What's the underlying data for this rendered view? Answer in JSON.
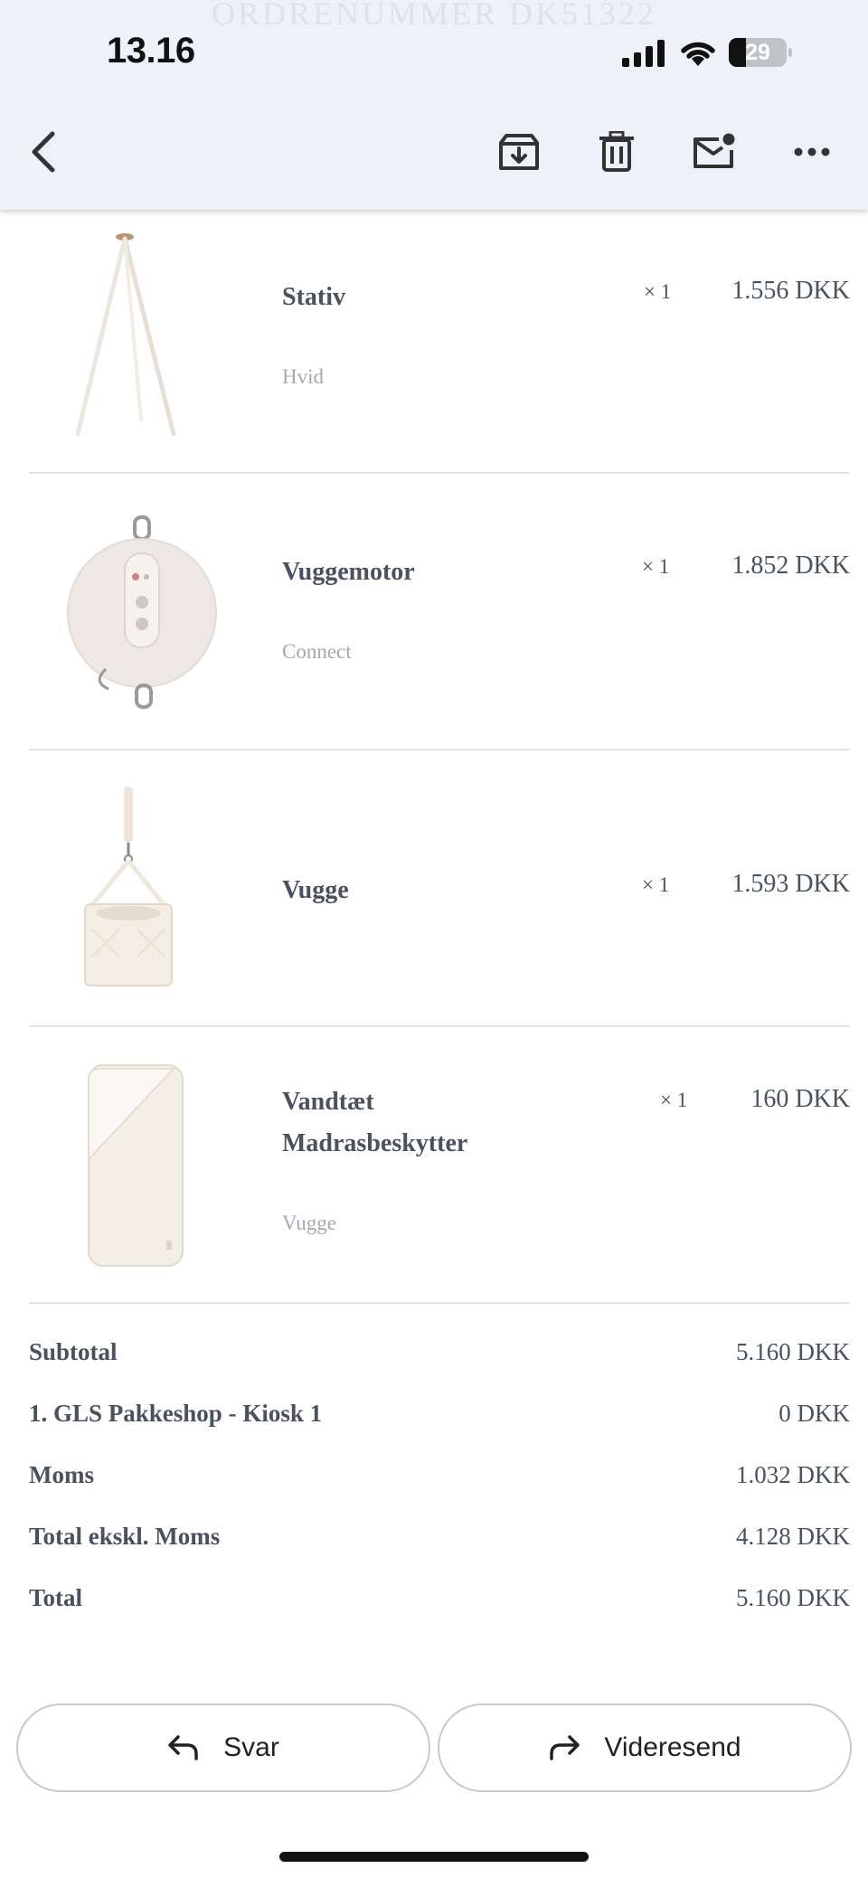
{
  "status_bar": {
    "time": "13.16",
    "battery": "29",
    "battery_level": 0.29
  },
  "background_header": {
    "title": "ORDRENUMMER DK51322"
  },
  "toolbar": {
    "icons": [
      "back-arrow-icon",
      "archive-icon",
      "trash-icon",
      "mark-unread-icon",
      "more-icon"
    ]
  },
  "items": [
    {
      "name": "Stativ",
      "variant": "Hvid",
      "qty": "× 1",
      "price": "1.556 DKK",
      "image": "tripod-stand-image"
    },
    {
      "name": "Vuggemotor",
      "variant": "Connect",
      "qty": "× 1",
      "price": "1.852 DKK",
      "image": "cradle-motor-image"
    },
    {
      "name": "Vugge",
      "variant": "",
      "qty": "× 1",
      "price": "1.593 DKK",
      "image": "hanging-cradle-image"
    },
    {
      "name": "Vandtæt Madrasbeskytter",
      "variant": "Vugge",
      "qty": "× 1",
      "price": "160 DKK",
      "image": "mattress-protector-image"
    }
  ],
  "totals": [
    {
      "label": "Subtotal",
      "value": "5.160 DKK"
    },
    {
      "label": "1. GLS Pakkeshop - Kiosk 1",
      "value": "0 DKK"
    },
    {
      "label": "Moms",
      "value": "1.032 DKK"
    },
    {
      "label": "Total ekskl. Moms",
      "value": "4.128 DKK"
    },
    {
      "label": "Total",
      "value": "5.160 DKK"
    }
  ],
  "actions": {
    "reply_label": "Svar",
    "forward_label": "Videresend"
  },
  "colors": {
    "text": "#4a5260",
    "muted": "#a4a8b0",
    "divider": "#e1e3e8",
    "toolbar_bg": "#eef1f7"
  }
}
